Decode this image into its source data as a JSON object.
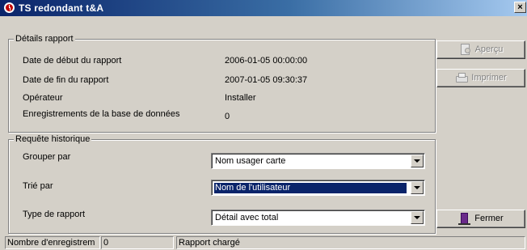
{
  "window": {
    "title": "TS redondant t&A",
    "close_glyph": "×"
  },
  "report_details": {
    "legend": "Détails rapport",
    "rows": [
      {
        "label": "Date de début du rapport",
        "value": "2006-01-05 00:00:00"
      },
      {
        "label": "Date de fin du rapport",
        "value": "2007-01-05 09:30:37"
      },
      {
        "label": "Opérateur",
        "value": "Installer"
      },
      {
        "label": "Enregistrements de la base de données",
        "value": "0"
      }
    ]
  },
  "history_query": {
    "legend": "Requête historique",
    "group_by": {
      "label": "Grouper par",
      "value": "Nom usager carte"
    },
    "sort_by": {
      "label": "Trié par",
      "value": "Nom de l'utilisateur"
    },
    "report_type": {
      "label": "Type de rapport",
      "value": "Détail avec total"
    }
  },
  "buttons": {
    "preview": {
      "label": "Aperçu",
      "icon": "preview-icon",
      "enabled": false
    },
    "print": {
      "label": "Imprimer",
      "icon": "printer-icon",
      "enabled": false
    },
    "close": {
      "label": "Fermer",
      "icon": "door-exit-icon",
      "enabled": true
    }
  },
  "statusbar": {
    "records_label": "Nombre d'enregistrem",
    "records_count": "0",
    "message": "Rapport chargé"
  },
  "colors": {
    "titlebar_start": "#0a246a",
    "titlebar_end": "#a6caf0",
    "face": "#d4d0c8",
    "selection": "#0a246a"
  }
}
